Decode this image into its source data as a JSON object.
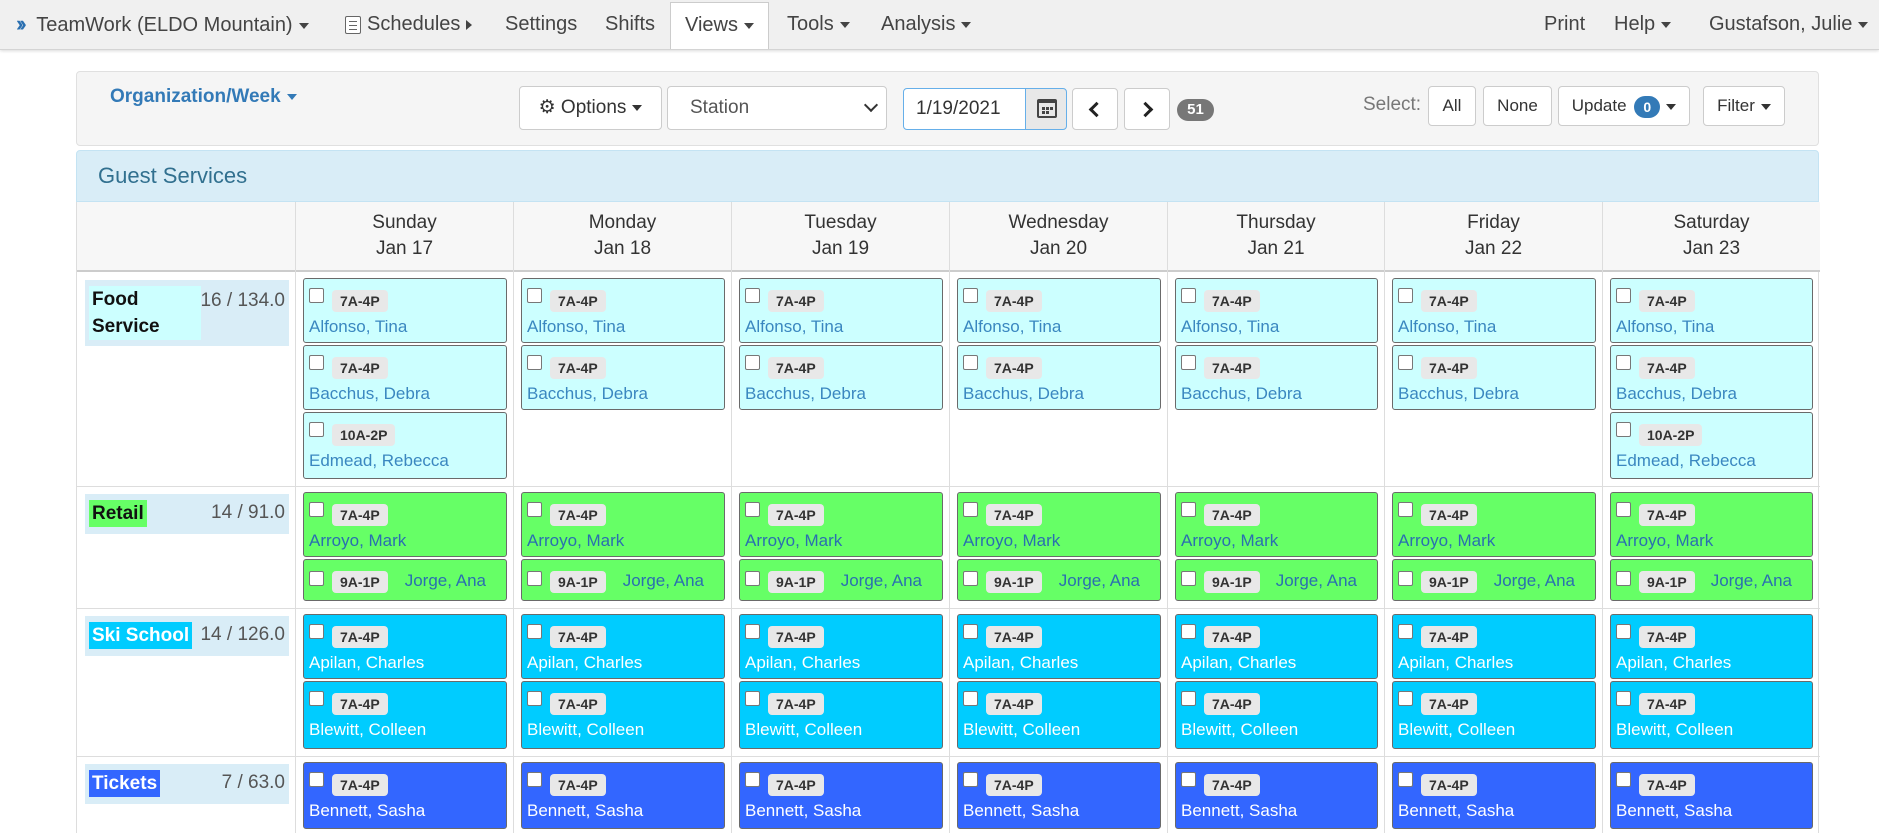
{
  "nav": {
    "brand": "TeamWork (ELDO Mountain)",
    "schedules": "Schedules",
    "settings": "Settings",
    "shifts": "Shifts",
    "views": "Views",
    "tools": "Tools",
    "analysis": "Analysis",
    "print": "Print",
    "help": "Help",
    "user": "Gustafson, Julie"
  },
  "toolbar": {
    "view_title": "Organization/Week",
    "options_label": "Options",
    "station_value": "Station",
    "date_value": "1/19/2021",
    "week_badge": "51",
    "select_label": "Select:",
    "all_label": "All",
    "none_label": "None",
    "update_label": "Update",
    "update_count": "0",
    "filter_label": "Filter"
  },
  "section": {
    "title": "Guest Services"
  },
  "days": [
    {
      "name": "Sunday",
      "date": "Jan 17"
    },
    {
      "name": "Monday",
      "date": "Jan 18"
    },
    {
      "name": "Tuesday",
      "date": "Jan 19"
    },
    {
      "name": "Wednesday",
      "date": "Jan 20"
    },
    {
      "name": "Thursday",
      "date": "Jan 21"
    },
    {
      "name": "Friday",
      "date": "Jan 22"
    },
    {
      "name": "Saturday",
      "date": "Jan 23"
    }
  ],
  "groups": [
    {
      "name": "Food Service",
      "count": "16 / 134.0",
      "name_bg": "#ccffff",
      "name_color": "#111"
    },
    {
      "name": "Retail",
      "count": "14 / 91.0",
      "name_bg": "#66ff66",
      "name_color": "#111"
    },
    {
      "name": "Ski School",
      "count": "14 / 126.0",
      "name_bg": "#00ccff",
      "name_color": "#ffffff"
    },
    {
      "name": "Tickets",
      "count": "7 / 63.0",
      "name_bg": "#3366ff",
      "name_color": "#ffffff"
    }
  ],
  "shifts": {
    "alfonso_time": "7A-4P",
    "alfonso_name": "Alfonso, Tina",
    "bacchus_time": "7A-4P",
    "bacchus_name": "Bacchus, Debra",
    "edmead_time": "10A-2P",
    "edmead_name": "Edmead, Rebecca",
    "arroyo_time": "7A-4P",
    "arroyo_name": "Arroyo, Mark",
    "jorge_time": "9A-1P",
    "jorge_name": "Jorge, Ana",
    "apilan_time": "7A-4P",
    "apilan_name": "Apilan, Charles",
    "blewitt_time": "7A-4P",
    "blewitt_name": "Blewitt, Colleen",
    "bennett_time": "7A-4P",
    "bennett_name": "Bennett, Sasha"
  },
  "colors": {
    "food": "#ccffff",
    "retail": "#66ff66",
    "ski": "#00ccff",
    "tickets": "#3366ff",
    "accent": "#337ab7"
  }
}
